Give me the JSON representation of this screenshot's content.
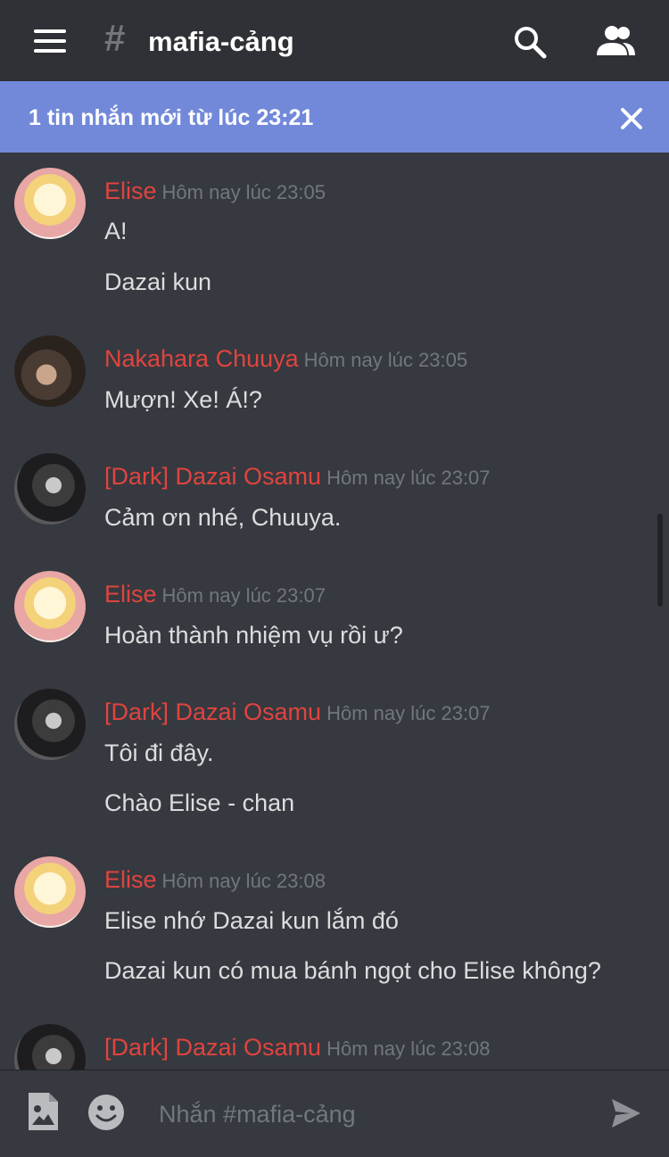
{
  "header": {
    "hash": "#",
    "channel": "mafia-cảng"
  },
  "banner": {
    "text": "1 tin nhắn mới từ lúc 23:21"
  },
  "messages": [
    {
      "author": "Elise",
      "time": "Hôm nay lúc 23:05",
      "lines": [
        "A!",
        "Dazai kun"
      ]
    },
    {
      "author": "Nakahara Chuuya",
      "time": "Hôm nay lúc 23:05",
      "lines": [
        "Mượn! Xe! Á!?"
      ]
    },
    {
      "author": "[Dark] Dazai Osamu",
      "time": "Hôm nay lúc 23:07",
      "lines": [
        "Cảm ơn nhé, Chuuya."
      ]
    },
    {
      "author": "Elise",
      "time": "Hôm nay lúc 23:07",
      "lines": [
        "Hoàn thành nhiệm vụ rồi ư?"
      ]
    },
    {
      "author": "[Dark] Dazai Osamu",
      "time": "Hôm nay lúc 23:07",
      "lines": [
        "Tôi đi đây.",
        "Chào Elise - chan"
      ]
    },
    {
      "author": "Elise",
      "time": "Hôm nay lúc 23:08",
      "lines": [
        "Elise nhớ Dazai kun lắm đó",
        "Dazai kun có mua bánh ngọt cho Elise không?"
      ]
    },
    {
      "author": "[Dark] Dazai Osamu",
      "time": "Hôm nay lúc 23:08",
      "lines": []
    }
  ],
  "composer": {
    "placeholder": "Nhắn #mafia-cảng"
  },
  "colors": {
    "background": "#36393f",
    "topbar": "#2f3136",
    "banner": "#7289da",
    "author": "#e0443f",
    "timestamp": "#72767d",
    "text": "#dcddde"
  },
  "icons": [
    "menu-icon",
    "hash-icon",
    "search-icon",
    "members-icon",
    "close-icon",
    "image-icon",
    "emoji-icon",
    "send-icon"
  ]
}
